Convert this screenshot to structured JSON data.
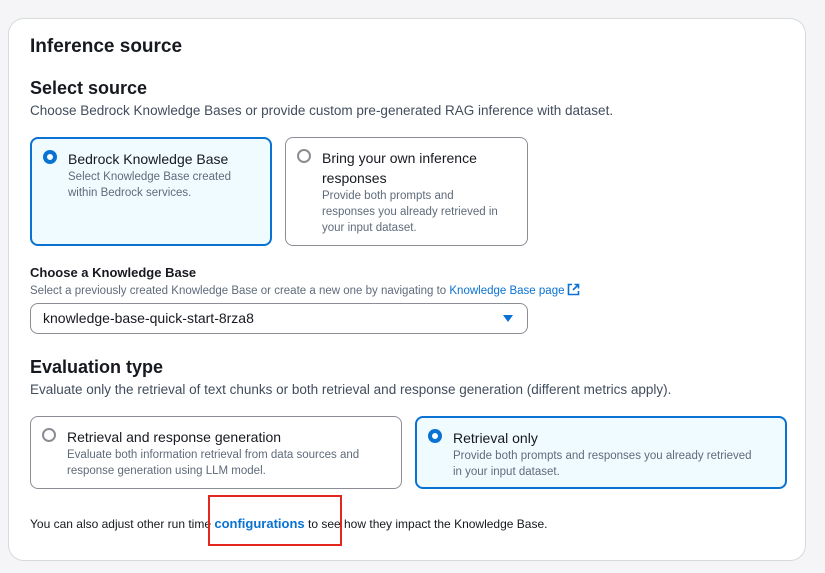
{
  "section": {
    "title": "Inference source"
  },
  "select_source": {
    "heading": "Select source",
    "description": "Choose Bedrock Knowledge Bases or provide custom pre-generated RAG inference with dataset.",
    "options": [
      {
        "title": "Bedrock Knowledge Base",
        "description_lines": [
          "Select Knowledge Base created",
          "within Bedrock services."
        ],
        "selected": true
      },
      {
        "title_lines": [
          "Bring your own inference",
          "responses"
        ],
        "description_lines": [
          "Provide both prompts and",
          "responses you already retrieved in",
          "your input dataset."
        ],
        "selected": false
      }
    ]
  },
  "knowledge_base": {
    "label": "Choose a Knowledge Base",
    "hint": "Select a previously created Knowledge Base or create a new one by navigating to",
    "link_text": "Knowledge Base page",
    "selected_value": "knowledge-base-quick-start-8rza8"
  },
  "evaluation_type": {
    "heading": "Evaluation type",
    "description": "Evaluate only the retrieval of text chunks or both retrieval and response generation (different metrics apply).",
    "options": [
      {
        "title": "Retrieval and response generation",
        "description_lines": [
          "Evaluate both information retrieval from data sources and",
          "response generation using LLM model."
        ],
        "selected": false
      },
      {
        "title": "Retrieval only",
        "description_lines": [
          "Provide both prompts and responses you already retrieved",
          "in your input dataset."
        ],
        "selected": true
      }
    ]
  },
  "footer": {
    "prefix": "You can also adjust other run time",
    "link_text": "configurations",
    "suffix": "to see how they impact the Knowledge Base."
  },
  "colors": {
    "accent": "#0972d3",
    "highlight_box": "#e3271e",
    "selected_tile_bg": "#f0fbff"
  }
}
